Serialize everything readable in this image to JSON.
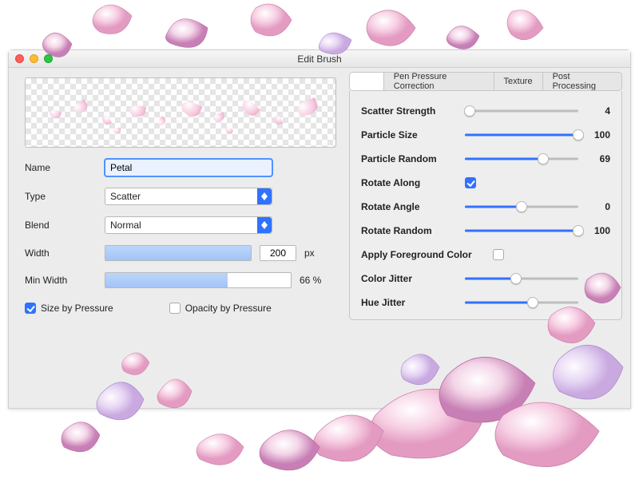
{
  "window": {
    "title": "Edit Brush"
  },
  "tabs": {
    "active": "",
    "items": [
      "",
      "Pen Pressure Correction",
      "Texture",
      "Post Processing"
    ]
  },
  "left": {
    "name_label": "Name",
    "name_value": "Petal",
    "type_label": "Type",
    "type_value": "Scatter",
    "blend_label": "Blend",
    "blend_value": "Normal",
    "width_label": "Width",
    "width_value": "200",
    "width_unit": "px",
    "width_fill_pct": 100,
    "minwidth_label": "Min Width",
    "minwidth_value": "66 %",
    "minwidth_fill_pct": 66,
    "size_by_pressure_label": "Size by Pressure",
    "size_by_pressure_checked": true,
    "opacity_by_pressure_label": "Opacity by Pressure",
    "opacity_by_pressure_checked": false
  },
  "sliders": {
    "scatter_strength": {
      "label": "Scatter Strength",
      "value": 4,
      "pct": 4
    },
    "particle_size": {
      "label": "Particle Size",
      "value": 100,
      "pct": 100
    },
    "particle_random": {
      "label": "Particle Random",
      "value": 69,
      "pct": 69
    },
    "rotate_along": {
      "label": "Rotate Along",
      "checked": true
    },
    "rotate_angle": {
      "label": "Rotate Angle",
      "value": 0,
      "pct": 50
    },
    "rotate_random": {
      "label": "Rotate Random",
      "value": 100,
      "pct": 100
    },
    "apply_fg": {
      "label": "Apply Foreground Color",
      "checked": false
    },
    "color_jitter": {
      "label": "Color Jitter",
      "value": "",
      "pct": 45
    },
    "hue_jitter": {
      "label": "Hue Jitter",
      "value": "",
      "pct": 60
    }
  },
  "colors": {
    "accent": "#2f72ff"
  }
}
